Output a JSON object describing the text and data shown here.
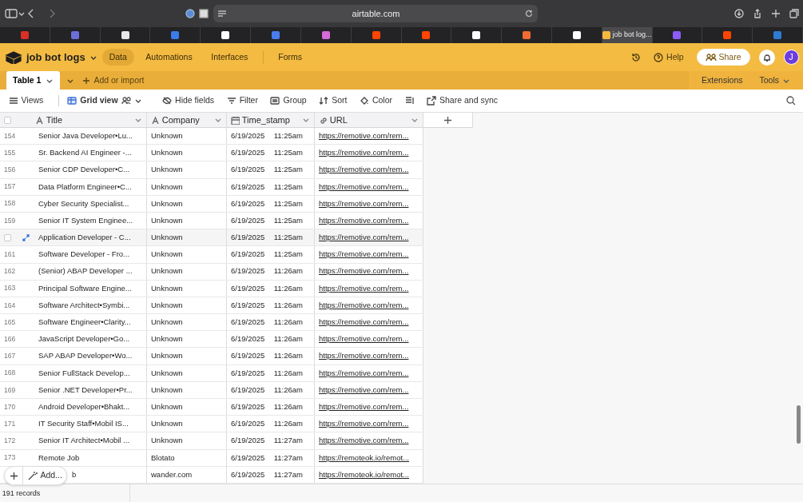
{
  "browser": {
    "address": "airtable.com",
    "tabs": [
      {
        "selected": false,
        "color": "#d93025"
      },
      {
        "selected": false,
        "color": "#6b6fd8"
      },
      {
        "selected": false,
        "color": "#e8e8e8"
      },
      {
        "selected": false,
        "color": "#3b7bea"
      },
      {
        "selected": false,
        "color": "#ffffff"
      },
      {
        "selected": false,
        "color": "#4a7cf0"
      },
      {
        "selected": false,
        "color": "#d56ad8"
      },
      {
        "selected": false,
        "color": "#ff4500"
      },
      {
        "selected": false,
        "color": "#ff4500"
      },
      {
        "selected": false,
        "color": "#ffffff"
      },
      {
        "selected": false,
        "color": "#f06a35"
      },
      {
        "selected": false,
        "color": "#ffffff"
      },
      {
        "selected": true,
        "color": "#f3b93f",
        "label": "job bot log..."
      },
      {
        "selected": false,
        "color": "#8b5cf6"
      },
      {
        "selected": false,
        "color": "#ff4500"
      },
      {
        "selected": false,
        "color": "#2d7cd1"
      }
    ]
  },
  "base": {
    "name": "job bot logs",
    "nav": [
      {
        "label": "Data",
        "selected": true
      },
      {
        "label": "Automations",
        "selected": false
      },
      {
        "label": "Interfaces",
        "selected": false
      },
      {
        "label": "Forms",
        "selected": false
      }
    ],
    "help": "Help",
    "share": "Share",
    "avatar": "J"
  },
  "tables": {
    "tabs": [
      {
        "label": "Table 1",
        "selected": true
      }
    ],
    "add": "Add or import",
    "extensions": "Extensions",
    "tools": "Tools"
  },
  "toolbar": [
    {
      "kind": "views",
      "label": "Views"
    },
    {
      "kind": "grid",
      "label": "Grid view"
    },
    {
      "kind": "hide",
      "label": "Hide fields"
    },
    {
      "kind": "filter",
      "label": "Filter"
    },
    {
      "kind": "group",
      "label": "Group"
    },
    {
      "kind": "sort",
      "label": "Sort"
    },
    {
      "kind": "color",
      "label": "Color"
    },
    {
      "kind": "height"
    },
    {
      "kind": "share",
      "label": "Share and sync"
    }
  ],
  "table": {
    "select_all_checked": false,
    "columns": [
      {
        "kind": "text",
        "label": "Title"
      },
      {
        "kind": "text",
        "label": "Company"
      },
      {
        "kind": "date",
        "label": "Time_stamp"
      },
      {
        "kind": "url",
        "label": "URL"
      }
    ],
    "rows": [
      {
        "number": "154",
        "title": "Senior Java Developer•Lu...",
        "company": "Unknown",
        "date": "6/19/2025",
        "time": "11:25am",
        "url": "https://remotive.com/rem..."
      },
      {
        "number": "155",
        "title": "Sr. Backend AI Engineer -...",
        "company": "Unknown",
        "date": "6/19/2025",
        "time": "11:25am",
        "url": "https://remotive.com/rem..."
      },
      {
        "number": "156",
        "title": "Senior CDP Developer•C...",
        "company": "Unknown",
        "date": "6/19/2025",
        "time": "11:25am",
        "url": "https://remotive.com/rem..."
      },
      {
        "number": "157",
        "title": "Data Platform Engineer•C...",
        "company": "Unknown",
        "date": "6/19/2025",
        "time": "11:25am",
        "url": "https://remotive.com/rem..."
      },
      {
        "number": "158",
        "title": "Cyber Security Specialist...",
        "company": "Unknown",
        "date": "6/19/2025",
        "time": "11:25am",
        "url": "https://remotive.com/rem..."
      },
      {
        "number": "159",
        "title": "Senior IT System Enginee...",
        "company": "Unknown",
        "date": "6/19/2025",
        "time": "11:25am",
        "url": "https://remotive.com/rem..."
      },
      {
        "hovered": true,
        "checked": false,
        "title": "Application Developer - C...",
        "company": "Unknown",
        "date": "6/19/2025",
        "time": "11:25am",
        "url": "https://remotive.com/rem..."
      },
      {
        "number": "161",
        "title": "Software Developer - Fro...",
        "company": "Unknown",
        "date": "6/19/2025",
        "time": "11:25am",
        "url": "https://remotive.com/rem..."
      },
      {
        "number": "162",
        "title": "(Senior) ABAP Developer ...",
        "company": "Unknown",
        "date": "6/19/2025",
        "time": "11:26am",
        "url": "https://remotive.com/rem..."
      },
      {
        "number": "163",
        "title": "Principal Software Engine...",
        "company": "Unknown",
        "date": "6/19/2025",
        "time": "11:26am",
        "url": "https://remotive.com/rem..."
      },
      {
        "number": "164",
        "title": "Software Architect•Symbi...",
        "company": "Unknown",
        "date": "6/19/2025",
        "time": "11:26am",
        "url": "https://remotive.com/rem..."
      },
      {
        "number": "165",
        "title": "Software Engineer•Clarity...",
        "company": "Unknown",
        "date": "6/19/2025",
        "time": "11:26am",
        "url": "https://remotive.com/rem..."
      },
      {
        "number": "166",
        "title": "JavaScript Developer•Go...",
        "company": "Unknown",
        "date": "6/19/2025",
        "time": "11:26am",
        "url": "https://remotive.com/rem..."
      },
      {
        "number": "167",
        "title": "SAP ABAP Developer•Wo...",
        "company": "Unknown",
        "date": "6/19/2025",
        "time": "11:26am",
        "url": "https://remotive.com/rem..."
      },
      {
        "number": "168",
        "title": "Senior FullStack Develop...",
        "company": "Unknown",
        "date": "6/19/2025",
        "time": "11:26am",
        "url": "https://remotive.com/rem..."
      },
      {
        "number": "169",
        "title": "Senior .NET Developer•Pr...",
        "company": "Unknown",
        "date": "6/19/2025",
        "time": "11:26am",
        "url": "https://remotive.com/rem..."
      },
      {
        "number": "170",
        "title": "Android Developer•Bhakt...",
        "company": "Unknown",
        "date": "6/19/2025",
        "time": "11:26am",
        "url": "https://remotive.com/rem..."
      },
      {
        "number": "171",
        "title": "IT Security Staff•Mobil IS...",
        "company": "Unknown",
        "date": "6/19/2025",
        "time": "11:26am",
        "url": "https://remotive.com/rem..."
      },
      {
        "number": "172",
        "title": "Senior IT Architect•Mobil ...",
        "company": "Unknown",
        "date": "6/19/2025",
        "time": "11:27am",
        "url": "https://remotive.com/rem..."
      },
      {
        "number": "173",
        "title": "Remote Job",
        "company": "Blotato",
        "date": "6/19/2025",
        "time": "11:27am",
        "url": "https://remoteok.io/remot..."
      },
      {
        "title": "b",
        "company": "wander.com",
        "date": "6/19/2025",
        "time": "11:27am",
        "url": "https://remoteok.io/remot..."
      }
    ]
  },
  "add_button": "Add...",
  "status_bar": "191 records"
}
